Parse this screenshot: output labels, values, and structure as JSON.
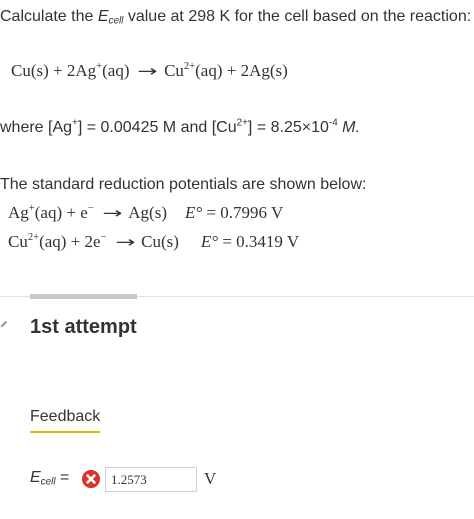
{
  "question": {
    "before": "Calculate the ",
    "symbol": "E",
    "symbol_sub": "cell",
    "after": " value at 298 K for the cell based on the reaction:"
  },
  "reaction": {
    "lhs": "Cu(s) + 2Ag",
    "lhs_sup": "+",
    "lhs_end": "(aq)",
    "rhs": "Cu",
    "rhs_sup": "2+",
    "rhs_end": "(aq) + 2Ag(s)"
  },
  "concentrations": {
    "p1": "where [Ag",
    "s1": "+",
    "p2": "] = 0.00425 M and [Cu",
    "s2": "2+",
    "p3": "] = 8.25×10",
    "s3": "-4",
    "p4": " M."
  },
  "potentials": {
    "intro": "The standard reduction potentials are shown below:",
    "r1": {
      "a": "Ag",
      "a_sup": "+",
      "b": "(aq) + e",
      "b_sup": "−",
      "product": "Ag(s)",
      "e_label": "E°",
      "value": " = 0.7996 V"
    },
    "r2": {
      "a": "Cu",
      "a_sup": "2+",
      "b": "(aq) + 2e",
      "b_sup": "−",
      "product": "Cu(s)",
      "e_label": "E°",
      "value": " = 0.3419 V"
    }
  },
  "attempt": {
    "title": "1st attempt"
  },
  "feedback": {
    "label": "Feedback"
  },
  "answer": {
    "symbol": "E",
    "symbol_sub": "cell",
    "equals": " =",
    "value": "1.2573",
    "unit": "V",
    "status_icon": "incorrect-x-icon",
    "status_color": "#d9342b"
  }
}
